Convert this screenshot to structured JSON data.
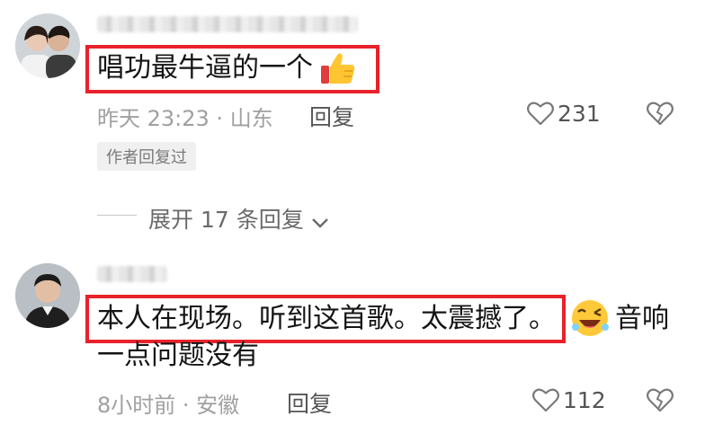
{
  "comments": [
    {
      "text": "唱功最牛逼的一个",
      "emoji": "thumbs-up-emoji",
      "time": "昨天 23:23",
      "location": "山东",
      "reply_label": "回复",
      "likes": "231",
      "author_badge": "作者回复过",
      "expand_label": "展开 17 条回复"
    },
    {
      "text_highlight": "本人在现场。听到这首歌。太震撼了。",
      "emoji": "laughing-wink-emoji",
      "text_tail": "音响",
      "text_line2": "一点问题没有",
      "time": "8小时前",
      "location": "安徽",
      "reply_label": "回复",
      "likes": "112"
    }
  ],
  "colors": {
    "highlight_box": "#e8222b",
    "meta_text": "#a0a0a0"
  }
}
